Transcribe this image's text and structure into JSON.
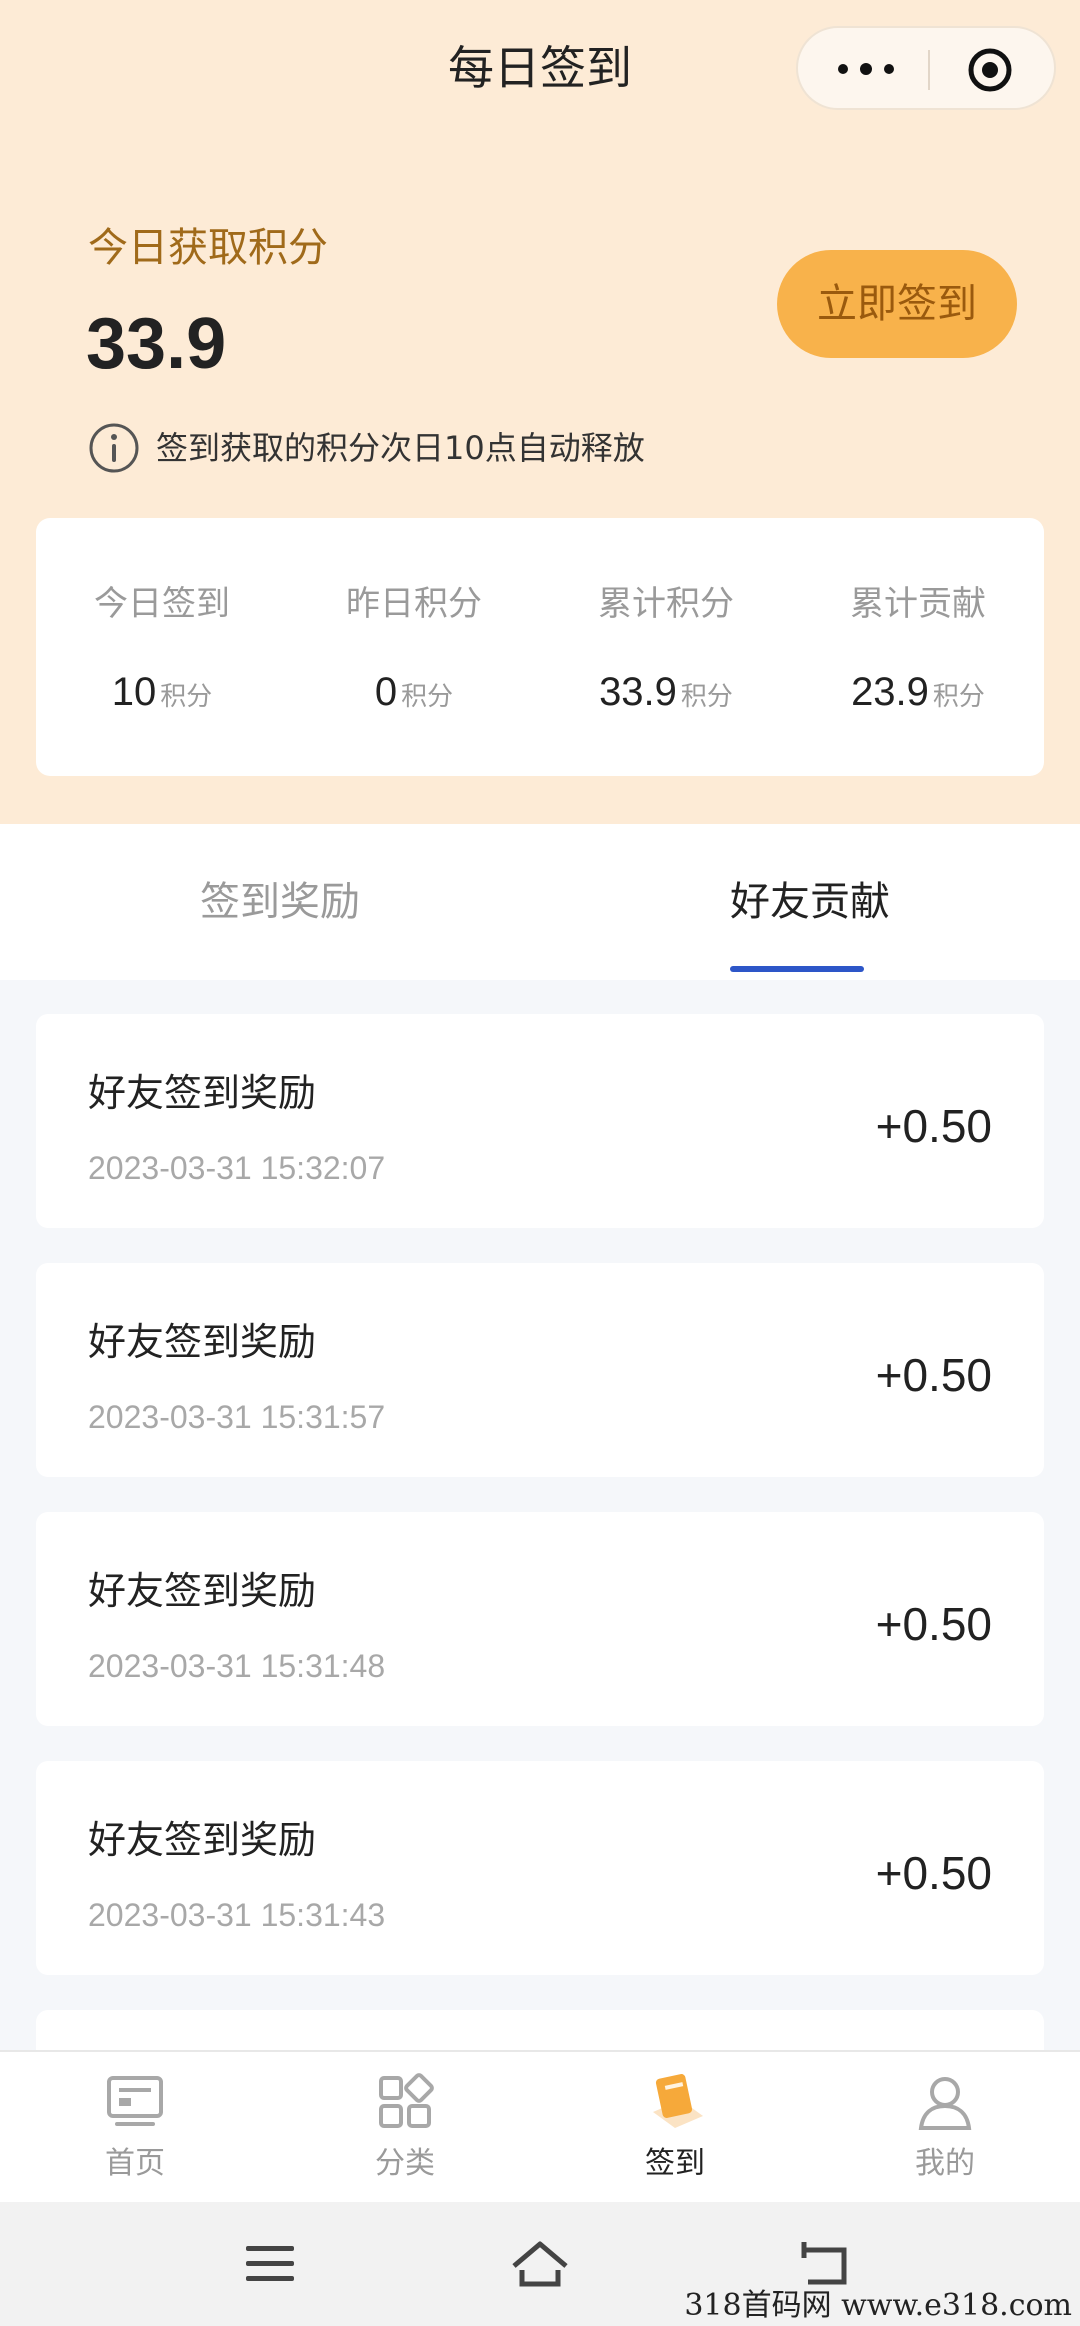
{
  "header": {
    "title": "每日签到"
  },
  "summary": {
    "points_label": "今日获取积分",
    "points_value": "33.9",
    "signin_button": "立即签到",
    "notice": "签到获取的积分次日10点自动释放"
  },
  "stats": [
    {
      "label": "今日签到",
      "value": "10",
      "unit": "积分"
    },
    {
      "label": "昨日积分",
      "value": "0",
      "unit": "积分"
    },
    {
      "label": "累计积分",
      "value": "33.9",
      "unit": "积分"
    },
    {
      "label": "累计贡献",
      "value": "23.9",
      "unit": "积分"
    }
  ],
  "tabs": [
    {
      "label": "签到奖励",
      "active": false
    },
    {
      "label": "好友贡献",
      "active": true
    }
  ],
  "records": [
    {
      "title": "好友签到奖励",
      "time": "2023-03-31 15:32:07",
      "amount": "+0.50"
    },
    {
      "title": "好友签到奖励",
      "time": "2023-03-31 15:31:57",
      "amount": "+0.50"
    },
    {
      "title": "好友签到奖励",
      "time": "2023-03-31 15:31:48",
      "amount": "+0.50"
    },
    {
      "title": "好友签到奖励",
      "time": "2023-03-31 15:31:43",
      "amount": "+0.50"
    }
  ],
  "tabbar": [
    {
      "label": "首页",
      "icon": "monitor-icon",
      "active": false
    },
    {
      "label": "分类",
      "icon": "grid-icon",
      "active": false
    },
    {
      "label": "签到",
      "icon": "calendar-icon",
      "active": true
    },
    {
      "label": "我的",
      "icon": "user-icon",
      "active": false
    }
  ],
  "watermark": "318首码网 www.e318.com",
  "colors": {
    "top_bg": "#fdebd6",
    "accent": "#f8b24b",
    "label_brown": "#a06a1a",
    "tab_underline": "#2d56c8"
  }
}
